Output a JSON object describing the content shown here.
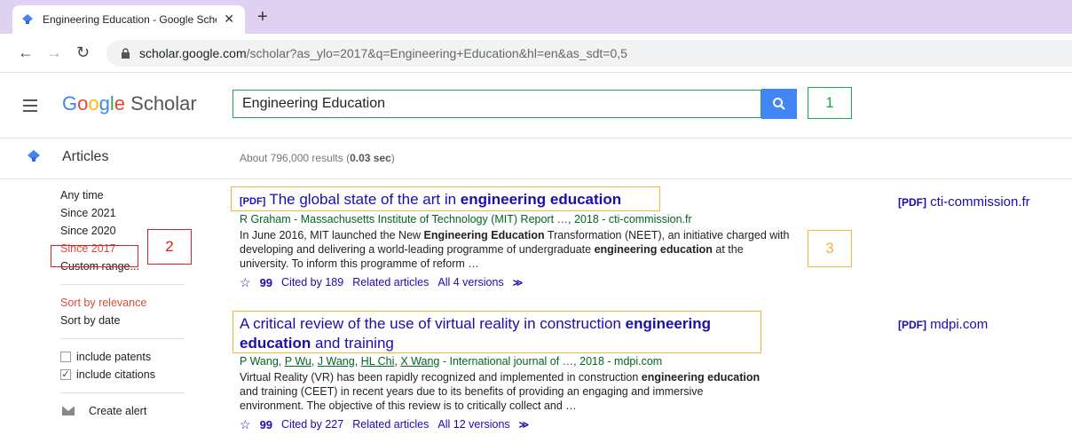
{
  "browser": {
    "tab_title": "Engineering Education - Google Scholar",
    "new_tab": "+",
    "url_host": "scholar.google.com",
    "url_path": "/scholar?as_ylo=2017&q=Engineering+Education&hl=en&as_sdt=0,5"
  },
  "header": {
    "logo_google": [
      "G",
      "o",
      "o",
      "g",
      "l",
      "e"
    ],
    "logo_scholar": "Scholar",
    "search_value": "Engineering Education"
  },
  "subheader": {
    "articles_label": "Articles",
    "results_prefix": "About 796,000 results (",
    "results_time": "0.03 sec",
    "results_suffix": ")"
  },
  "sidebar": {
    "time_filters": [
      "Any time",
      "Since 2021",
      "Since 2020",
      "Since 2017",
      "Custom range..."
    ],
    "sort_options": [
      "Sort by relevance",
      "Sort by date"
    ],
    "include_patents": "include patents",
    "include_citations": "include citations",
    "create_alert": "Create alert"
  },
  "annotations": {
    "label_1": "1",
    "label_2": "2",
    "label_3": "3"
  },
  "results": [
    {
      "pdf_tag": "[PDF]",
      "title_pre": "The global state of the art in ",
      "title_bold": "engineering education",
      "title_post": "",
      "authors": "R Graham - Massachusetts Institute of Technology (MIT) Report …, 2018 - cti-commission.fr",
      "snippet_1": "In June 2016, MIT launched the New ",
      "snippet_b1": "Engineering Education",
      "snippet_2": " Transformation (NEET), an initiative charged with developing and delivering a world-leading programme of undergraduate ",
      "snippet_b2": "engineering education",
      "snippet_3": " at the university. To inform this programme of reform …",
      "cited_by": "Cited by 189",
      "related": "Related articles",
      "versions": "All 4 versions",
      "side_tag": "[PDF]",
      "side_domain": "cti-commission.fr"
    },
    {
      "title_pre": "A critical review of the use of virtual reality in construction ",
      "title_bold": "engineering education",
      "title_post": " and training",
      "authors_plain_1": "P Wang, ",
      "author_links": [
        "P Wu",
        "J Wang",
        "HL Chi",
        "X Wang"
      ],
      "authors_tail": " - International journal of …, 2018 - mdpi.com",
      "snippet_1": "Virtual Reality (VR) has been rapidly recognized and implemented in construction ",
      "snippet_b1": "engineering education",
      "snippet_2": " and training (CEET) in recent years due to its benefits of providing an engaging and immersive environment. The objective of this review is to critically collect and …",
      "cited_by": "Cited by 227",
      "related": "Related articles",
      "versions": "All 12 versions",
      "side_tag": "[PDF]",
      "side_domain": "mdpi.com"
    }
  ]
}
